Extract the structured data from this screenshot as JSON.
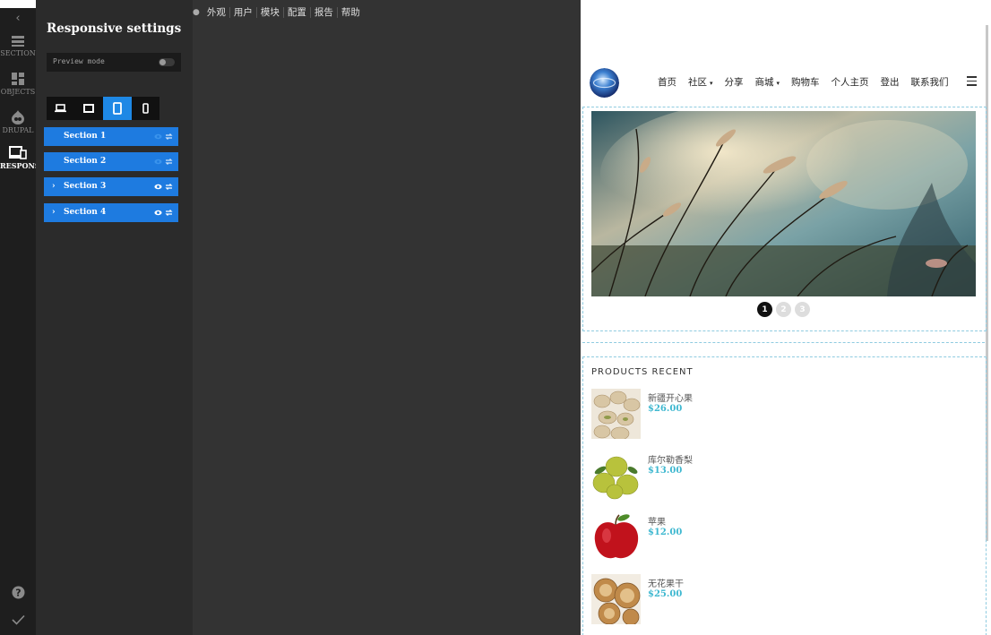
{
  "rail": {
    "items": [
      {
        "label": "SECTION",
        "icon": "section-icon"
      },
      {
        "label": "OBJECTS",
        "icon": "objects-icon"
      },
      {
        "label": "DRUPAL",
        "icon": "drupal-icon"
      },
      {
        "label": "RESPONS",
        "icon": "responsive-icon"
      }
    ],
    "help_icon": "help-icon",
    "check_icon": "check-icon"
  },
  "panel": {
    "title": "Responsive settings",
    "preview_mode_label": "Preview mode",
    "preview_mode_on": false,
    "devices": [
      "laptop-icon",
      "desktop-icon",
      "tablet-icon",
      "phone-icon"
    ],
    "active_device": 2,
    "sections": [
      {
        "label": "Section 1",
        "arrow": "",
        "visible": false
      },
      {
        "label": "Section 2",
        "arrow": "",
        "visible": false
      },
      {
        "label": "Section 3",
        "arrow": "›",
        "visible": true
      },
      {
        "label": "Section 4",
        "arrow": "›",
        "visible": true
      }
    ]
  },
  "topmenu": [
    "外观",
    "用户",
    "模块",
    "配置",
    "报告",
    "帮助"
  ],
  "site": {
    "nav": [
      {
        "label": "首页",
        "dropdown": false
      },
      {
        "label": "社区",
        "dropdown": true
      },
      {
        "label": "分享",
        "dropdown": false
      },
      {
        "label": "商城",
        "dropdown": true
      },
      {
        "label": "购物车",
        "dropdown": false
      },
      {
        "label": "个人主页",
        "dropdown": false
      },
      {
        "label": "登出",
        "dropdown": false
      },
      {
        "label": "联系我们",
        "dropdown": false
      }
    ],
    "caret": "▾",
    "slider_pages": [
      "1",
      "2",
      "3"
    ],
    "active_slide": 0,
    "products_title": "PRODUCTS RECENT",
    "products": [
      {
        "name": "新疆开心果",
        "price": "$26.00"
      },
      {
        "name": "库尔勒香梨",
        "price": "$13.00"
      },
      {
        "name": "苹果",
        "price": "$12.00"
      },
      {
        "name": "无花果干",
        "price": "$25.00"
      }
    ]
  },
  "colors": {
    "accent_blue": "#1e7be0",
    "price_cyan": "#3fb8d0",
    "panel_bg": "#2b2b2b",
    "canvas_bg": "#333333"
  }
}
